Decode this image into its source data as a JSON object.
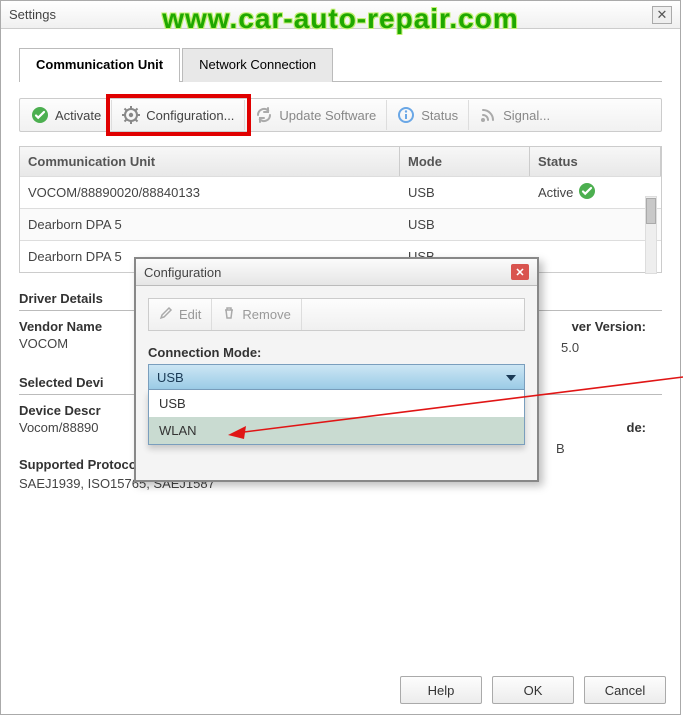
{
  "window": {
    "title": "Settings",
    "close_glyph": "✕"
  },
  "watermark": "www.car-auto-repair.com",
  "tabs": {
    "comm": "Communication Unit",
    "net": "Network Connection"
  },
  "toolbar": {
    "activate": "Activate",
    "configuration": "Configuration...",
    "update": "Update Software",
    "status": "Status",
    "signal": "Signal..."
  },
  "table": {
    "headers": {
      "cu": "Communication Unit",
      "mode": "Mode",
      "status": "Status"
    },
    "rows": [
      {
        "cu": "VOCOM/88890020/88840133",
        "mode": "USB",
        "status": "Active",
        "active": true
      },
      {
        "cu": "Dearborn DPA 5",
        "mode": "USB",
        "status": ""
      },
      {
        "cu": "Dearborn DPA 5",
        "mode": "USB",
        "status": ""
      }
    ]
  },
  "sections": {
    "driver_details": "Driver Details",
    "vendor_label": "Vendor Name",
    "vendor_value": "VOCOM",
    "driver_version_label": "ver Version:",
    "driver_version_value": "5.0",
    "selected_device": "Selected Devi",
    "device_descr_label": "Device Descr",
    "device_descr_value": "Vocom/88890",
    "mode_peek_label": "de:",
    "mode_peek_value": "B",
    "supported_protocols_label": "Supported Protocols:",
    "supported_protocols_value": "SAEJ1939, ISO15765, SAEJ1587"
  },
  "dialog": {
    "title": "Configuration",
    "edit": "Edit",
    "remove": "Remove",
    "connection_mode_label": "Connection Mode:",
    "selected": "USB",
    "options": [
      "USB",
      "WLAN"
    ]
  },
  "footer": {
    "help": "Help",
    "ok": "OK",
    "cancel": "Cancel"
  }
}
